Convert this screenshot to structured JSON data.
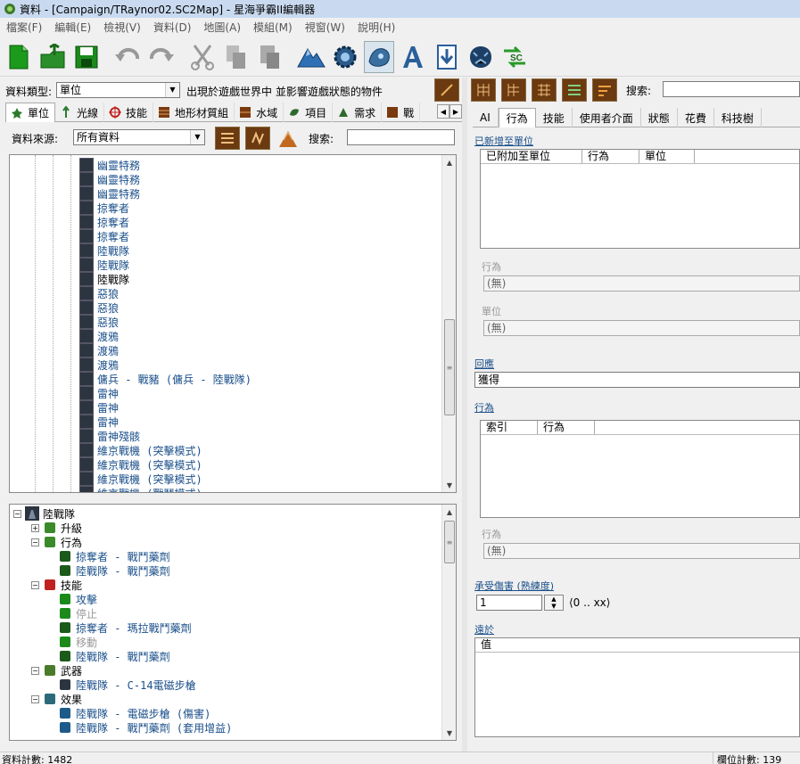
{
  "window": {
    "title": "資料 - [Campaign/TRaynor02.SC2Map] - 星海爭霸II編輯器"
  },
  "menu": [
    "檔案(F)",
    "編輯(E)",
    "檢視(V)",
    "資料(D)",
    "地圖(A)",
    "模組(M)",
    "視窗(W)",
    "說明(H)"
  ],
  "toolbar": {
    "icons": [
      "new-file",
      "open",
      "save",
      "undo",
      "redo",
      "cut",
      "copy",
      "paste",
      "terrain",
      "trigger",
      "data",
      "text",
      "import",
      "ai",
      "sc-publish"
    ]
  },
  "left": {
    "data_type_label": "資料類型:",
    "data_type_value": "單位",
    "data_type_desc": "出現於遊戲世界中 並影響遊戲狀態的物件",
    "tabs": [
      "單位",
      "光線",
      "技能",
      "地形材質組",
      "水域",
      "項目",
      "需求",
      "戰"
    ],
    "source_label": "資料來源:",
    "source_value": "所有資料",
    "search_label": "搜索:",
    "search_value": "",
    "list_items": [
      "幽靈特務",
      "幽靈特務",
      "幽靈特務",
      "掠奪者",
      "掠奪者",
      "掠奪者",
      "陸戰隊",
      "陸戰隊",
      "陸戰隊",
      "惡狼",
      "惡狼",
      "惡狼",
      "渡鴉",
      "渡鴉",
      "渡鴉",
      "傭兵 - 戰豬 (傭兵 - 陸戰隊)",
      "雷神",
      "雷神",
      "雷神",
      "雷神殘骸",
      "維京戰機 (突擊模式)",
      "維京戰機 (突擊模式)",
      "維京戰機 (突擊模式)",
      "維京戰機 (戰鬥模式)"
    ],
    "selected_index": 8,
    "tree": {
      "root": "陸戰隊",
      "nodes": [
        {
          "label": "升級",
          "level": 1,
          "expander": "+"
        },
        {
          "label": "行為",
          "level": 1,
          "expander": "-"
        },
        {
          "label": "掠奪者 - 戰鬥藥劑",
          "level": 2,
          "child": true
        },
        {
          "label": "陸戰隊 - 戰鬥藥劑",
          "level": 2,
          "child": true
        },
        {
          "label": "技能",
          "level": 1,
          "expander": "-"
        },
        {
          "label": "攻擊",
          "level": 2,
          "child": true
        },
        {
          "label": "停止",
          "level": 2,
          "child": true,
          "disabled": true
        },
        {
          "label": "掠奪者 - 瑪拉戰鬥藥劑",
          "level": 2,
          "child": true
        },
        {
          "label": "移動",
          "level": 2,
          "child": true,
          "disabled": true
        },
        {
          "label": "陸戰隊 - 戰鬥藥劑",
          "level": 2,
          "child": true
        },
        {
          "label": "武器",
          "level": 1,
          "expander": "-"
        },
        {
          "label": "陸戰隊 - C-14電磁步槍",
          "level": 2,
          "child": true
        },
        {
          "label": "效果",
          "level": 1,
          "expander": "-"
        },
        {
          "label": "陸戰隊 - 電磁步槍 (傷害)",
          "level": 2,
          "child": true
        },
        {
          "label": "陸戰隊 - 戰鬥藥劑 (套用增益)",
          "level": 2,
          "child": true
        }
      ]
    }
  },
  "right": {
    "search_label": "搜索:",
    "tabs": [
      "AI",
      "行為",
      "技能",
      "使用者介面",
      "狀態",
      "花費",
      "科技樹"
    ],
    "active_tab": 1,
    "sections": {
      "newly_added_units": "已新增至單位",
      "grid1_headers": [
        "已附加至單位",
        "行為",
        "單位"
      ],
      "behavior_label": "行為",
      "behavior_value": "(無)",
      "unit_label": "單位",
      "unit_value": "(無)",
      "response_label": "回應",
      "response_value": "獲得",
      "behaviors_label": "行為",
      "grid2_headers": [
        "索引",
        "行為"
      ],
      "behavior2_label": "行為",
      "behavior2_value": "(無)",
      "damage_label": "承受傷害 (熟練度)",
      "damage_value": "1",
      "damage_range": "⟨0 .. xx⟩",
      "dest_label": "遠於",
      "grid3_headers": [
        "值"
      ]
    }
  },
  "status": {
    "left": "資料計數: 1482",
    "right": "欄位計數: 139"
  }
}
